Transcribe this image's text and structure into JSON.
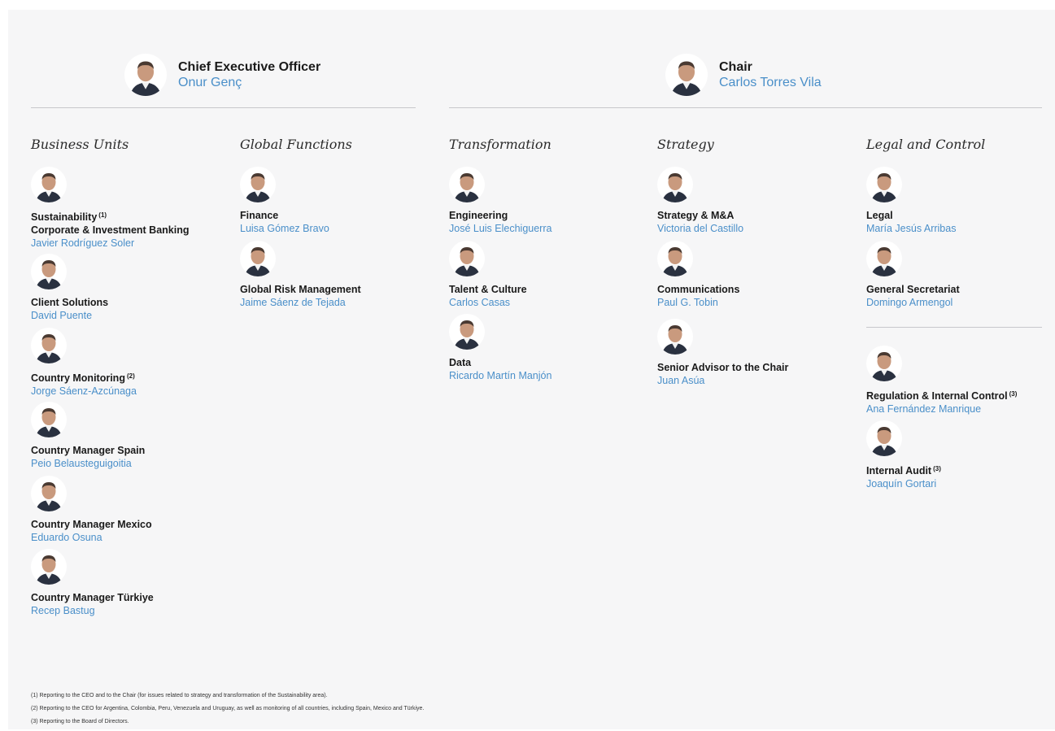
{
  "colors": {
    "name_blue": "#4a8fc9",
    "rule_gray": "#c8c8cc",
    "background": "#f6f6f7"
  },
  "ceo": {
    "role": "Chief Executive Officer",
    "name": "Onur Genç"
  },
  "chair": {
    "role": "Chair",
    "name": "Carlos Torres Vila"
  },
  "sections": {
    "business_units": {
      "title": "Business Units",
      "items": [
        {
          "role_line1": "Sustainability",
          "note1": "(1)",
          "role": "Corporate & Investment Banking",
          "name": "Javier Rodríguez Soler"
        },
        {
          "role": "Client Solutions",
          "name": "David Puente"
        },
        {
          "role": "Country Monitoring",
          "note": "(2)",
          "name": "Jorge Sáenz-Azcúnaga"
        },
        {
          "role": "Country Manager Spain",
          "name": "Peio Belausteguigoitia"
        },
        {
          "role": "Country Manager Mexico",
          "name": "Eduardo Osuna"
        },
        {
          "role": "Country Manager Türkiye",
          "name": "Recep Bastug"
        }
      ]
    },
    "global_functions": {
      "title": "Global Functions",
      "items": [
        {
          "role": "Finance",
          "name": "Luisa Gómez Bravo"
        },
        {
          "role": "Global Risk Management",
          "name": "Jaime Sáenz de Tejada"
        }
      ]
    },
    "transformation": {
      "title": "Transformation",
      "items": [
        {
          "role": "Engineering",
          "name": "José Luis Elechiguerra"
        },
        {
          "role": "Talent & Culture",
          "name": "Carlos Casas"
        },
        {
          "role": "Data",
          "name": "Ricardo Martín Manjón"
        }
      ]
    },
    "strategy": {
      "title": "Strategy",
      "items": [
        {
          "role": "Strategy & M&A",
          "name": "Victoria del Castillo"
        },
        {
          "role": "Communications",
          "name": "Paul G. Tobin"
        },
        {
          "role": "Senior Advisor to the Chair",
          "name": "Juan Asúa"
        }
      ]
    },
    "legal_control": {
      "title": "Legal and Control",
      "items": [
        {
          "role": "Legal",
          "name": "María Jesús Arribas"
        },
        {
          "role": "General Secretariat",
          "name": "Domingo Armengol"
        },
        {
          "role": "Regulation & Internal Control",
          "note": "(3)",
          "name": "Ana Fernández Manrique"
        },
        {
          "role": "Internal Audit",
          "note": "(3)",
          "name": "Joaquín Gortari"
        }
      ]
    }
  },
  "footnotes": [
    "(1) Reporting to the CEO and to the Chair (for issues related to strategy and transformation of the Sustainability area).",
    "(2) Reporting to the CEO for Argentina, Colombia, Peru, Venezuela and Uruguay, as well as monitoring of all countries, including Spain, Mexico and Türkiye.",
    "(3) Reporting to the Board of Directors."
  ]
}
